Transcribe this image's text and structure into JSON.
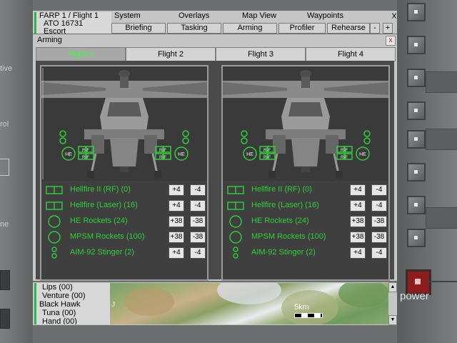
{
  "header": {
    "farp": [
      "FARP 1 / Flight 1",
      "ATO 16731",
      "Escort"
    ],
    "menu": [
      "System",
      "Overlays",
      "Map View",
      "Waypoints"
    ],
    "buttons": [
      "Briefing",
      "Tasking",
      "Arming",
      "Profiler",
      "Rehearse"
    ],
    "minus": "-",
    "plus": "+",
    "close": "X"
  },
  "bezel": {
    "left_fragments": [
      "tive",
      "rol",
      "ne"
    ],
    "power_label": "power"
  },
  "panel": {
    "title": "Arming",
    "close": "x",
    "tabs": [
      "Flight 1",
      "Flight 2",
      "Flight 3",
      "Flight 4"
    ],
    "active_tab": 0
  },
  "helicopter": {
    "pylon_labels": {
      "he": "HE",
      "rf": "R-F"
    }
  },
  "cards": [
    {
      "weapons": [
        {
          "icon": "R-F",
          "name": "Hellfire II (RF) (0)",
          "plus": "+4",
          "minus": "-4"
        },
        {
          "icon": "L-H",
          "name": "Hellfire (Laser) (16)",
          "plus": "+4",
          "minus": "-4"
        },
        {
          "icon": "HE",
          "name": "HE Rockets (24)",
          "plus": "+38",
          "minus": "-38"
        },
        {
          "icon": "MP",
          "name": "MPSM Rockets (100)",
          "plus": "+38",
          "minus": "-38"
        },
        {
          "icon": "stinger",
          "name": "AIM-92 Stinger (2)",
          "plus": "+4",
          "minus": "-4"
        }
      ]
    },
    {
      "weapons": [
        {
          "icon": "R-F",
          "name": "Hellfire II (RF) (0)",
          "plus": "+4",
          "minus": "-4"
        },
        {
          "icon": "L-H",
          "name": "Hellfire (Laser) (16)",
          "plus": "+4",
          "minus": "-4"
        },
        {
          "icon": "HE",
          "name": "HE Rockets (24)",
          "plus": "+38",
          "minus": "-38"
        },
        {
          "icon": "MP",
          "name": "MPSM Rockets (100)",
          "plus": "+38",
          "minus": "-38"
        },
        {
          "icon": "stinger",
          "name": "AIM-92 Stinger (2)",
          "plus": "+4",
          "minus": "-4"
        }
      ]
    }
  ],
  "units": [
    "Lips (00)",
    "Venture (00)",
    "Black Hawk",
    "Tuna (00)",
    "Hand (00)"
  ],
  "map": {
    "scale_label": "5km",
    "corner_label": "J"
  },
  "colors": {
    "accent_green": "#2fcf3a",
    "power_red": "#8e1c1c"
  }
}
